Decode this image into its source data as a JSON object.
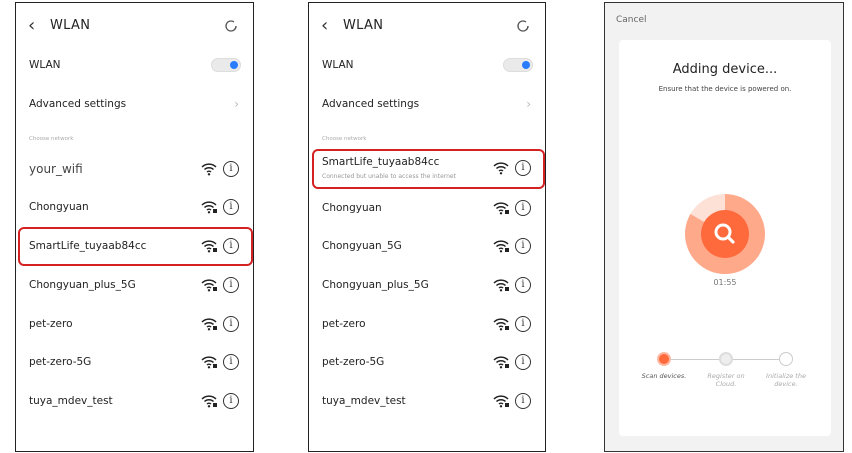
{
  "screen1": {
    "title": "WLAN",
    "wlan_label": "WLAN",
    "advanced": "Advanced settings",
    "section": "Choose network",
    "networks": [
      "your_wifi",
      "Chongyuan",
      "SmartLife_tuyaab84cc",
      "Chongyuan_plus_5G",
      "pet-zero",
      "pet-zero-5G",
      "tuya_mdev_test"
    ]
  },
  "screen2": {
    "title": "WLAN",
    "wlan_label": "WLAN",
    "advanced": "Advanced settings",
    "section": "Choose network",
    "connected": {
      "name": "SmartLife_tuyaab84cc",
      "status": "Connected but unable to access the internet"
    },
    "networks": [
      "Chongyuan",
      "Chongyuan_5G",
      "Chongyuan_plus_5G",
      "pet-zero",
      "pet-zero-5G",
      "tuya_mdev_test"
    ]
  },
  "screen3": {
    "cancel": "Cancel",
    "title": "Adding device...",
    "subtitle": "Ensure that the device is powered on.",
    "timer": "01:55",
    "steps": [
      "Scan devices.",
      "Register on Cloud.",
      "Initialize the device."
    ]
  },
  "colors": {
    "accent": "#ff6a3d",
    "toggle": "#2a7cff",
    "highlight": "#d42222"
  }
}
